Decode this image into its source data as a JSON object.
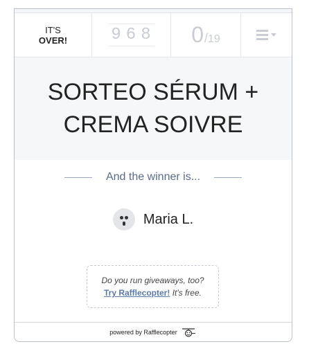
{
  "header": {
    "status_line1": "IT'S",
    "status_line2": "OVER!",
    "entries_digits": [
      "9",
      "6",
      "8"
    ],
    "score_value": "0",
    "score_separator": "/",
    "score_total": "19",
    "menu_icon": "hamburger-menu-icon"
  },
  "title": {
    "line1": "SORTEO SÉRUM +",
    "line2": "CREMA SOIVRE"
  },
  "winner": {
    "heading": "And the winner is...",
    "name": "Maria L."
  },
  "promo": {
    "question": "Do you run giveaways, too?",
    "link": "Try Rafflecopter!",
    "free": "It's free."
  },
  "footer": {
    "powered": "powered by Rafflecopter",
    "icon": "rafflecopter-logo-icon"
  },
  "colors": {
    "text": "#222222",
    "muted": "#c9cdd3",
    "accent": "#5a78a8",
    "winner_text": "#5a6b8a",
    "title_bg": "#f6f7f8"
  }
}
